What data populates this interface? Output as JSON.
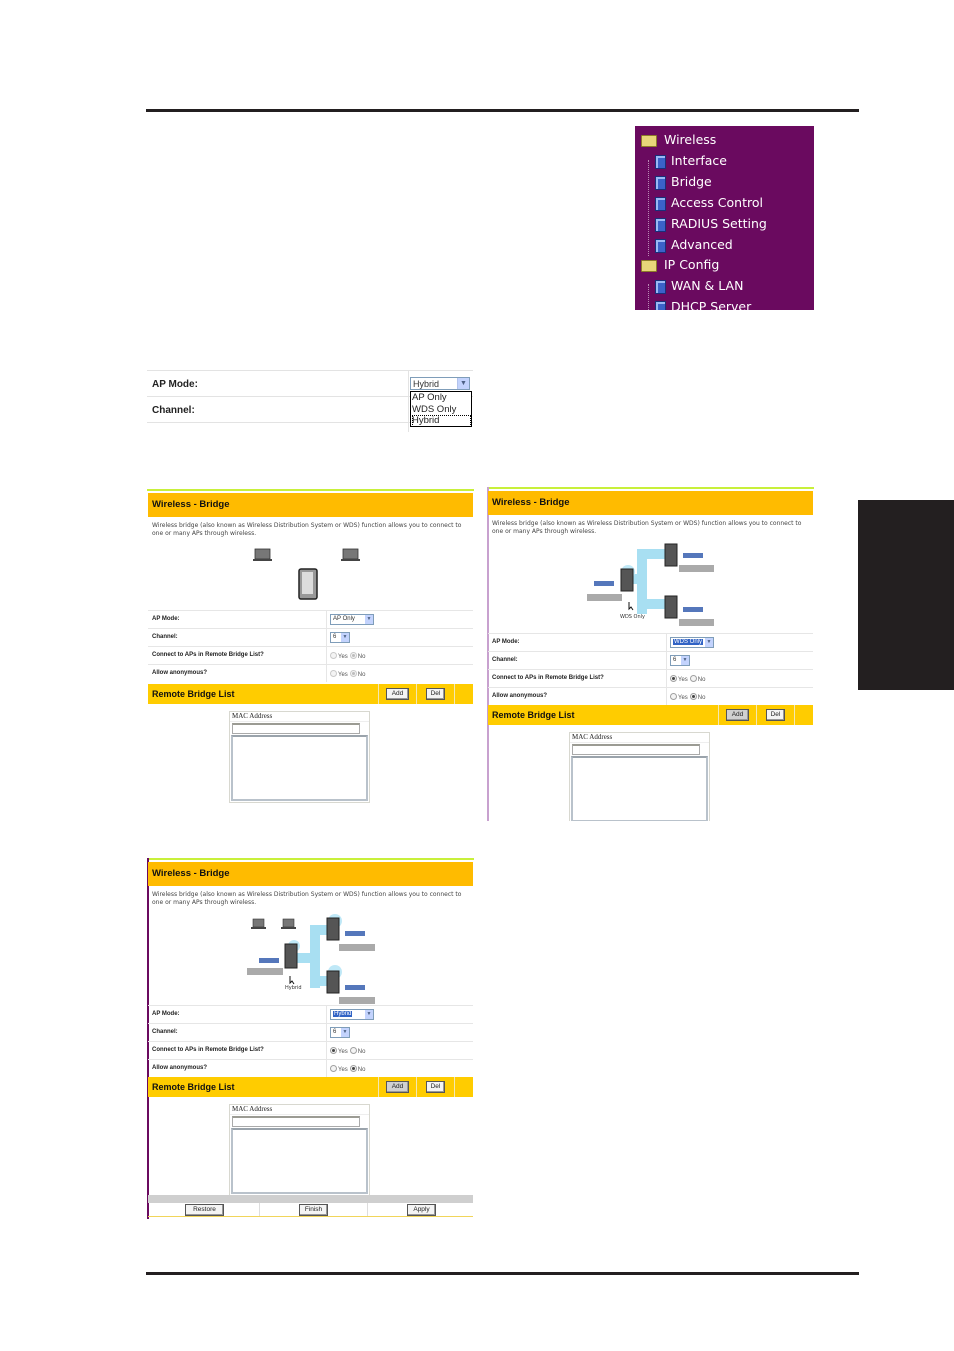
{
  "menu": {
    "items": [
      {
        "label": "Wireless",
        "type": "folder"
      },
      {
        "label": "Interface",
        "type": "page"
      },
      {
        "label": "Bridge",
        "type": "page"
      },
      {
        "label": "Access Control",
        "type": "page"
      },
      {
        "label": "RADIUS Setting",
        "type": "page"
      },
      {
        "label": "Advanced",
        "type": "page"
      },
      {
        "label": "IP Config",
        "type": "folder"
      },
      {
        "label": "WAN & LAN",
        "type": "page"
      },
      {
        "label": "DHCP Server",
        "type": "page"
      }
    ],
    "background": "#6a0a5f"
  },
  "ap_mode_snippet": {
    "ap_mode_label": "AP Mode:",
    "channel_label": "Channel:",
    "selected": "Hybrid",
    "options": [
      "AP Only",
      "WDS Only",
      "Hybrid"
    ]
  },
  "panels": [
    {
      "title": "Wireless - Bridge",
      "description": "Wireless bridge (also known as Wireless Distribution System or WDS) function allows you to connect to one or many APs through wireless.",
      "diagram_caption": "",
      "ap_mode_label": "AP Mode:",
      "ap_mode_value": "AP Only",
      "channel_label": "Channel:",
      "channel_value": "6",
      "connect_label": "Connect to APs in Remote Bridge List?",
      "connect_value": "No",
      "anon_label": "Allow anonymous?",
      "anon_value": "No",
      "yes": "Yes",
      "no": "No",
      "remote_list_title": "Remote Bridge List",
      "add_label": "Add",
      "del_label": "Del",
      "mac_label": "MAC Address"
    },
    {
      "title": "Wireless - Bridge",
      "description": "Wireless bridge (also known as Wireless Distribution System or WDS) function allows you to connect to one or many APs through wireless.",
      "diagram_caption": "WDS Only",
      "ap_mode_label": "AP Mode:",
      "ap_mode_value": "WDS Only",
      "channel_label": "Channel:",
      "channel_value": "6",
      "connect_label": "Connect to APs in Remote Bridge List?",
      "connect_value": "Yes",
      "anon_label": "Allow anonymous?",
      "anon_value": "No",
      "yes": "Yes",
      "no": "No",
      "remote_list_title": "Remote Bridge List",
      "add_label": "Add",
      "del_label": "Del",
      "mac_label": "MAC Address"
    },
    {
      "title": "Wireless - Bridge",
      "description": "Wireless bridge (also known as Wireless Distribution System or WDS) function allows you to connect to one or many APs through wireless.",
      "diagram_caption": "Hybrid",
      "ap_mode_label": "AP Mode:",
      "ap_mode_value": "Hybrid",
      "channel_label": "Channel:",
      "channel_value": "6",
      "connect_label": "Connect to APs in Remote Bridge List?",
      "connect_value": "Yes",
      "anon_label": "Allow anonymous?",
      "anon_value": "No",
      "yes": "Yes",
      "no": "No",
      "remote_list_title": "Remote Bridge List",
      "add_label": "Add",
      "del_label": "Del",
      "mac_label": "MAC Address",
      "footer_buttons": [
        "Restore",
        "Finish",
        "Apply"
      ]
    }
  ],
  "colors": {
    "header_orange": "#ffbb00",
    "list_bar_yellow": "#ffcc00",
    "accent_green": "#c8f03a",
    "selection_blue": "#3163c5",
    "side_tab": "#231f20"
  }
}
